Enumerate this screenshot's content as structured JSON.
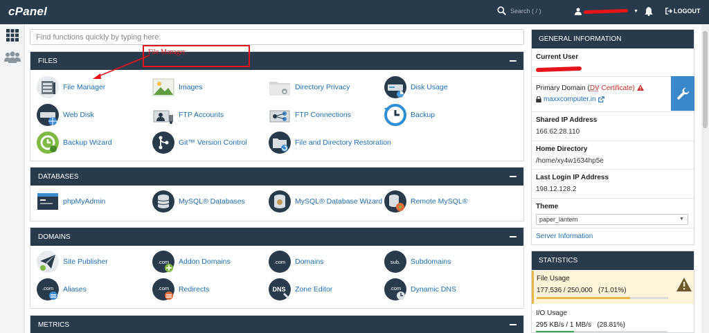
{
  "topbar": {
    "logo": "cPanel",
    "search_placeholder": "Search ( / )",
    "logout_label": "LOGOUT"
  },
  "main": {
    "search_placeholder": "Find functions quickly by typing here."
  },
  "annotation": {
    "text": "File Manager"
  },
  "panels": {
    "files": {
      "title": "FILES",
      "items": [
        "File Manager",
        "Images",
        "Directory Privacy",
        "Disk Usage",
        "Web Disk",
        "FTP Accounts",
        "FTP Connections",
        "Backup",
        "Backup Wizard",
        "Git™ Version Control",
        "File and Directory Restoration"
      ]
    },
    "databases": {
      "title": "DATABASES",
      "items": [
        "phpMyAdmin",
        "MySQL® Databases",
        "MySQL® Database Wizard",
        "Remote MySQL®"
      ]
    },
    "domains": {
      "title": "DOMAINS",
      "items": [
        "Site Publisher",
        "Addon Domains",
        "Domains",
        "Subdomains",
        "Aliases",
        "Redirects",
        "Zone Editor",
        "Dynamic DNS"
      ],
      "icon_text": {
        "com": ".com",
        "sub": "sub.",
        "dns": "DNS"
      }
    },
    "metrics": {
      "title": "METRICS"
    }
  },
  "general": {
    "title": "GENERAL INFORMATION",
    "current_user_label": "Current User",
    "primary_domain_label": "Primary Domain",
    "dv_open": "(",
    "dv_label": "DV",
    "dv_certificate": " Certificate)",
    "primary_domain": "maxxcomputer.in",
    "shared_ip_label": "Shared IP Address",
    "shared_ip": "166.62.28.110",
    "home_dir_label": "Home Directory",
    "home_dir": "/home/xy4w1634hp5e",
    "last_login_label": "Last Login IP Address",
    "last_login_ip": "198.12.128.2",
    "theme_label": "Theme",
    "theme_value": "paper_lantern",
    "server_info_link": "Server Information"
  },
  "statistics": {
    "title": "STATISTICS",
    "file_usage_label": "File Usage",
    "file_usage_value": "177,536 / 250,000   (71.01%)",
    "file_usage_fraction": 0.7101,
    "io_usage_label": "I/O Usage",
    "io_usage_value": "295 KB/s / 1 MB/s   (28.81%)",
    "io_usage_fraction": 0.2881
  },
  "colors": {
    "header_bg": "#293a4a",
    "link": "#1f6fb0",
    "annotation": "#e3141b",
    "warning": "#e8b54a",
    "io_bar": "#3aa655"
  }
}
